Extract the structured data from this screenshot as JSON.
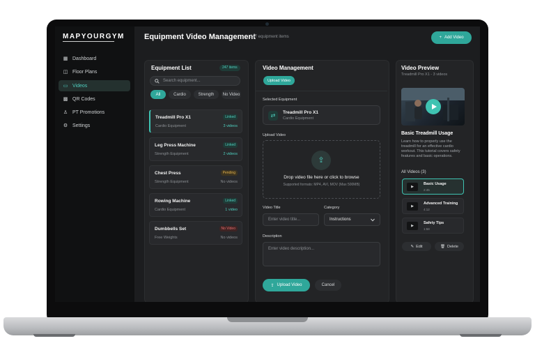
{
  "brand": "MAPYOURGYM",
  "sidebar": {
    "items": [
      {
        "icon": "dashboard-icon",
        "glyph": "▦",
        "label": "Dashboard"
      },
      {
        "icon": "floor-plans-icon",
        "glyph": "◫",
        "label": "Floor Plans"
      },
      {
        "icon": "video-icon",
        "glyph": "▭",
        "label": "Videos"
      },
      {
        "icon": "qr-code-icon",
        "glyph": "▩",
        "label": "QR Codes"
      },
      {
        "icon": "user-icon",
        "glyph": "♙",
        "label": "PT Promotions"
      },
      {
        "icon": "gear-icon",
        "glyph": "⚙",
        "label": "Settings"
      }
    ],
    "active": "Videos"
  },
  "header": {
    "title": "Equipment Video Management",
    "subtitle": "247 equipment items",
    "add_button": "Add Video",
    "add_glyph": "+"
  },
  "equipment_list": {
    "title": "Equipment List",
    "count_badge": "247 items",
    "search_placeholder": "Search equipment...",
    "filters": [
      "All",
      "Cardio",
      "Strength",
      "No Video"
    ],
    "items": [
      {
        "name": "Treadmill Pro X1",
        "category": "Cardio Equipment",
        "status": "Linked",
        "videos": "3 videos"
      },
      {
        "name": "Leg Press Machine",
        "category": "Strength Equipment",
        "status": "Linked",
        "videos": "2 videos"
      },
      {
        "name": "Chest Press",
        "category": "Strength Equipment",
        "status": "Pending",
        "videos": "No videos"
      },
      {
        "name": "Rowing Machine",
        "category": "Cardio Equipment",
        "status": "Linked",
        "videos": "1 video"
      },
      {
        "name": "Dumbbells Set",
        "category": "Free Weights",
        "status": "No Video",
        "videos": "No videos"
      }
    ]
  },
  "video_management": {
    "title": "Video Management",
    "upload_tab": "Upload Video",
    "selected_label": "Selected Equipment",
    "selected_name": "Treadmill Pro X1",
    "selected_category": "Cardio Equipment",
    "upload_label": "Upload Video",
    "drop_title": "Drop video file here or click to browse",
    "drop_formats": "Supported formats: MP4, AVI, MOV (Max 500MB)",
    "title_label": "Video Title",
    "title_placeholder": "Enter video title...",
    "category_label": "Category",
    "category_value": "Instructions",
    "description_label": "Description",
    "description_placeholder": "Enter video description...",
    "submit": "Upload Video",
    "cancel": "Cancel"
  },
  "preview": {
    "title": "Video Preview",
    "subtitle": "Treadmill Pro X1 - 3 videos",
    "video_title": "Basic Treadmill Usage",
    "description": "Learn how to properly use the treadmill for an effective cardio workout. This tutorial covers safety features and basic operations.",
    "all_videos_label": "All Videos (3)",
    "videos": [
      {
        "name": "Basic Usage",
        "duration": "2:45"
      },
      {
        "name": "Advanced Training",
        "duration": "4:12"
      },
      {
        "name": "Safety Tips",
        "duration": "1:58"
      }
    ],
    "edit": "Edit",
    "delete": "Delete"
  },
  "colors": {
    "accent": "#2fa79a",
    "background": "#1c1d1f",
    "sidebar": "#101112"
  }
}
